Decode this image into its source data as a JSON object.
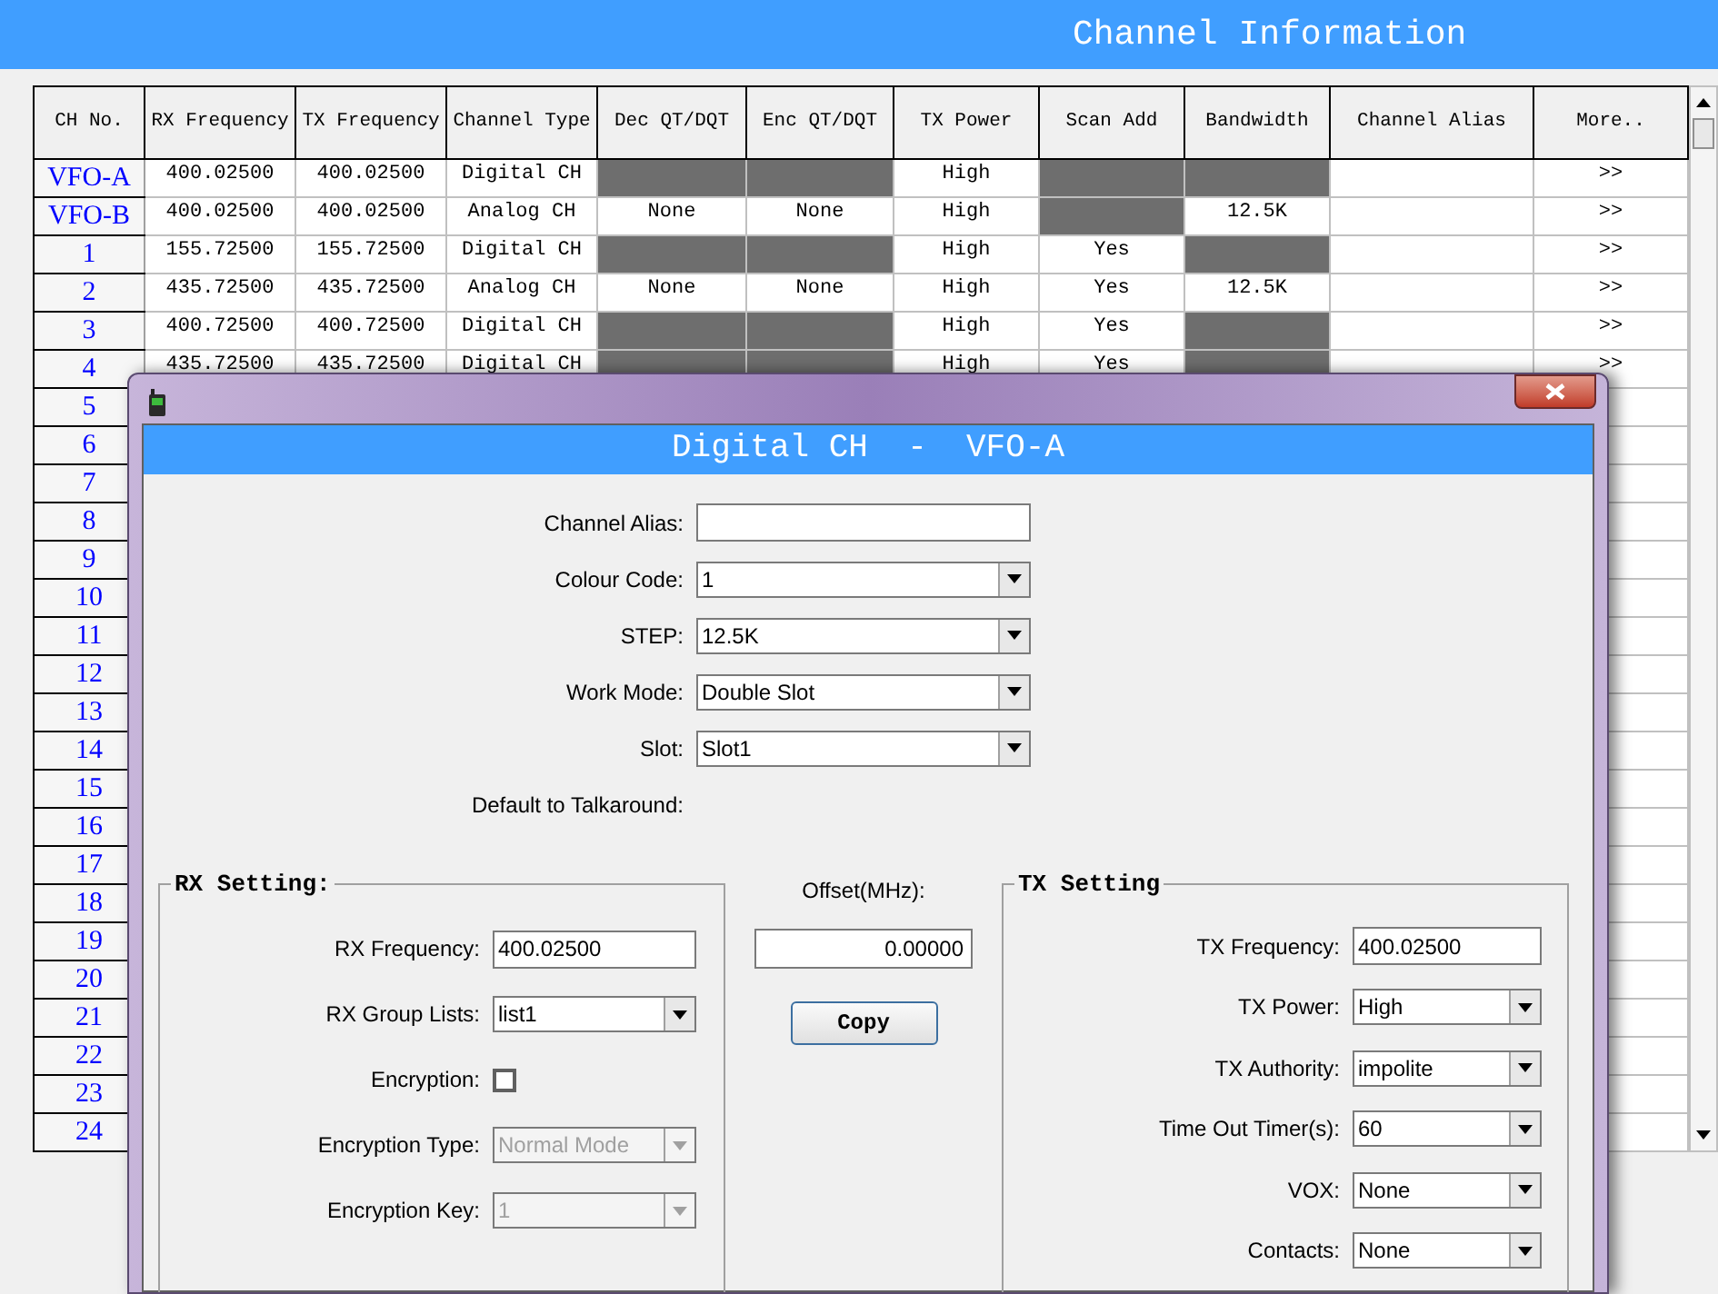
{
  "title": "Channel Information",
  "table": {
    "columns": [
      "CH No.",
      "RX Frequency",
      "TX Frequency",
      "Channel Type",
      "Dec QT/DQT",
      "Enc QT/DQT",
      "TX Power",
      "Scan Add",
      "Bandwidth",
      "Channel Alias",
      "More.."
    ],
    "rows": [
      {
        "ch": "VFO-A",
        "cells": [
          {
            "text": "400.02500",
            "shaded": false
          },
          {
            "text": "400.02500",
            "shaded": false
          },
          {
            "text": "Digital CH",
            "shaded": false
          },
          {
            "shaded": true
          },
          {
            "shaded": true
          },
          {
            "text": "High",
            "shaded": false
          },
          {
            "shaded": true
          },
          {
            "shaded": true
          }
        ],
        "more": ">>"
      },
      {
        "ch": "VFO-B",
        "cells": [
          {
            "text": "400.02500",
            "shaded": false
          },
          {
            "text": "400.02500",
            "shaded": false
          },
          {
            "text": "Analog CH",
            "shaded": false
          },
          {
            "text": "None",
            "shaded": false
          },
          {
            "text": "None",
            "shaded": false
          },
          {
            "text": "High",
            "shaded": false
          },
          {
            "shaded": true
          },
          {
            "text": "12.5K",
            "shaded": false
          }
        ],
        "more": ">>"
      },
      {
        "ch": "1",
        "cells": [
          {
            "text": "155.72500",
            "shaded": false
          },
          {
            "text": "155.72500",
            "shaded": false
          },
          {
            "text": "Digital CH",
            "shaded": false
          },
          {
            "shaded": true
          },
          {
            "shaded": true
          },
          {
            "text": "High",
            "shaded": false
          },
          {
            "text": "Yes",
            "shaded": false
          },
          {
            "shaded": true
          }
        ],
        "more": ">>"
      },
      {
        "ch": "2",
        "cells": [
          {
            "text": "435.72500",
            "shaded": false
          },
          {
            "text": "435.72500",
            "shaded": false
          },
          {
            "text": "Analog CH",
            "shaded": false
          },
          {
            "text": "None",
            "shaded": false
          },
          {
            "text": "None",
            "shaded": false
          },
          {
            "text": "High",
            "shaded": false
          },
          {
            "text": "Yes",
            "shaded": false
          },
          {
            "text": "12.5K",
            "shaded": false
          }
        ],
        "more": ">>"
      },
      {
        "ch": "3",
        "cells": [
          {
            "text": "400.72500",
            "shaded": false
          },
          {
            "text": "400.72500",
            "shaded": false
          },
          {
            "text": "Digital CH",
            "shaded": false
          },
          {
            "shaded": true
          },
          {
            "shaded": true
          },
          {
            "text": "High",
            "shaded": false
          },
          {
            "text": "Yes",
            "shaded": false
          },
          {
            "shaded": true
          }
        ],
        "more": ">>"
      },
      {
        "ch": "4",
        "cells": [
          {
            "text": "435.72500",
            "shaded": false
          },
          {
            "text": "435.72500",
            "shaded": false
          },
          {
            "text": "Digital CH",
            "shaded": false
          },
          {
            "shaded": true
          },
          {
            "shaded": true
          },
          {
            "text": "High",
            "shaded": false
          },
          {
            "text": "Yes",
            "shaded": false
          },
          {
            "shaded": true
          }
        ],
        "more": ">>"
      },
      {
        "ch": "5"
      },
      {
        "ch": "6"
      },
      {
        "ch": "7"
      },
      {
        "ch": "8"
      },
      {
        "ch": "9"
      },
      {
        "ch": "10"
      },
      {
        "ch": "11"
      },
      {
        "ch": "12"
      },
      {
        "ch": "13"
      },
      {
        "ch": "14"
      },
      {
        "ch": "15"
      },
      {
        "ch": "16"
      },
      {
        "ch": "17"
      },
      {
        "ch": "18"
      },
      {
        "ch": "19"
      },
      {
        "ch": "20"
      },
      {
        "ch": "21"
      },
      {
        "ch": "22"
      },
      {
        "ch": "23"
      },
      {
        "ch": "24"
      }
    ]
  },
  "dialog": {
    "title": "Digital CH  -  VFO-A",
    "fields": [
      {
        "label": "Channel Alias:",
        "kind": "text"
      },
      {
        "label": "Colour Code:",
        "kind": "select",
        "value": "1"
      },
      {
        "label": "STEP:",
        "kind": "select",
        "value": "12.5K"
      },
      {
        "label": "Work Mode:",
        "kind": "select",
        "value": "Double Slot"
      },
      {
        "label": "Slot:",
        "kind": "select",
        "value": "Slot1"
      },
      {
        "label": "Default to Talkaround:",
        "kind": "label"
      }
    ],
    "rx_setting": {
      "legend": "RX Setting:",
      "fields": [
        {
          "label": "RX Frequency:",
          "kind": "text",
          "value": "400.02500",
          "disabled": false
        },
        {
          "label": "RX Group Lists:",
          "kind": "select",
          "value": "list1",
          "disabled": false
        },
        {
          "label": "Encryption:",
          "kind": "checkbox",
          "checked": false,
          "disabled": false
        },
        {
          "label": "Encryption Type:",
          "kind": "select",
          "value": "Normal Mode",
          "disabled": true
        },
        {
          "label": "Encryption Key:",
          "kind": "select",
          "value": "1",
          "disabled": true
        }
      ]
    },
    "offset": {
      "label": "Offset(MHz):",
      "value": "0.00000"
    },
    "copy_button": "Copy",
    "tx_setting": {
      "legend": "TX Setting",
      "fields": [
        {
          "label": "TX Frequency:",
          "kind": "text",
          "value": "400.02500"
        },
        {
          "label": "TX Power:",
          "kind": "select",
          "value": "High"
        },
        {
          "label": "TX Authority:",
          "kind": "select",
          "value": "impolite"
        },
        {
          "label": "Time Out Timer(s):",
          "kind": "select",
          "value": "60"
        },
        {
          "label": "VOX:",
          "kind": "select",
          "value": "None"
        },
        {
          "label": "Contacts:",
          "kind": "select",
          "value": "None"
        }
      ]
    }
  }
}
